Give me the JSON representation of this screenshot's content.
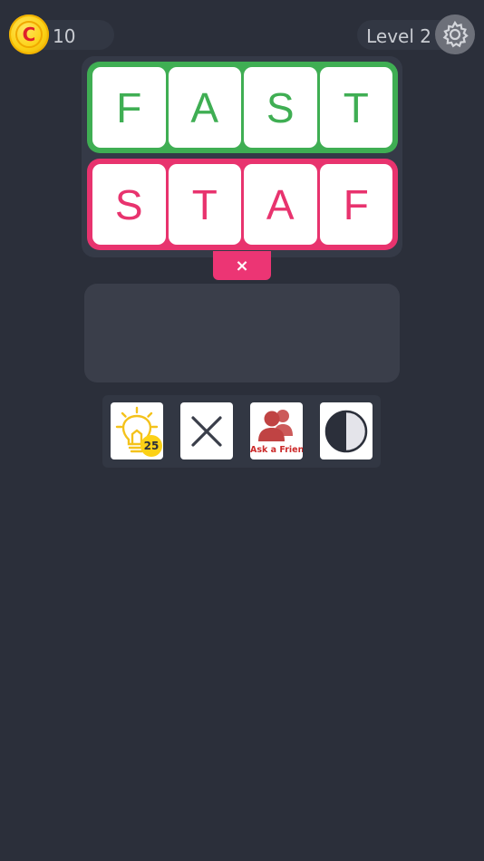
{
  "header": {
    "coin_symbol": "C",
    "coins": "10",
    "level_label": "Level 2",
    "icons": {
      "coin": "coin-icon",
      "settings": "gear-icon"
    }
  },
  "board": {
    "target_word": [
      "F",
      "A",
      "S",
      "T"
    ],
    "guess_word": [
      "S",
      "T",
      "A",
      "F"
    ],
    "clear_symbol": "×",
    "colors": {
      "target": "#3fae53",
      "guess": "#e8336e"
    }
  },
  "powerups": [
    {
      "name": "hint",
      "icon": "lightbulb-icon",
      "cost": "25"
    },
    {
      "name": "remove",
      "icon": "x-icon"
    },
    {
      "name": "ask-friend",
      "icon": "people-icon",
      "label": "Ask a Friend"
    },
    {
      "name": "theme",
      "icon": "half-moon-icon"
    }
  ]
}
